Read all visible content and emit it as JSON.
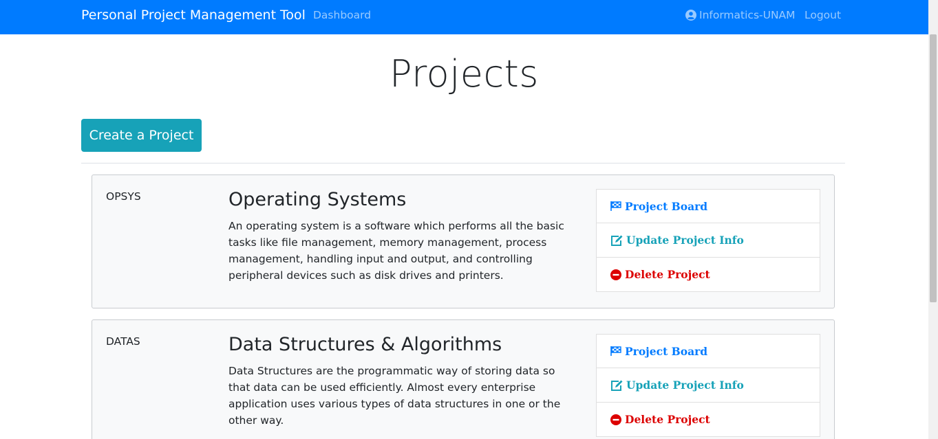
{
  "navbar": {
    "brand": "Personal Project Management Tool",
    "dashboard": "Dashboard",
    "user": "Informatics-UNAM",
    "logout": "Logout",
    "color": "#007bff"
  },
  "page": {
    "title": "Projects",
    "create_button": "Create a Project"
  },
  "actions": {
    "board": "Project Board",
    "update": "Update Project Info",
    "delete": "Delete Project"
  },
  "projects": [
    {
      "id": "OPSYS",
      "name": "Operating Systems",
      "description": "An operating system is a software which performs all the basic tasks like file management, memory management, process management, handling input and output, and controlling peripheral devices such as disk drives and printers."
    },
    {
      "id": "DATAS",
      "name": "Data Structures & Algorithms",
      "description": "Data Structures are the programmatic way of storing data so that data can be used efficiently. Almost every enterprise application uses various types of data structures in one or the other way."
    }
  ],
  "icons": {
    "board": "flag-checkered-icon",
    "update": "edit-icon",
    "delete": "minus-circle-icon",
    "user": "user-circle-icon"
  }
}
